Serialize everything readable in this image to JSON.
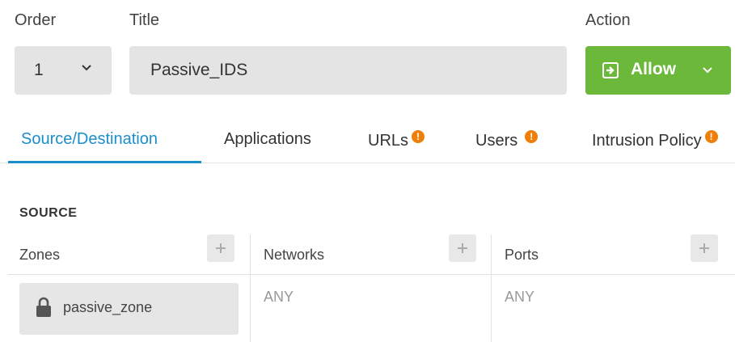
{
  "header": {
    "order_label": "Order",
    "title_label": "Title",
    "action_label": "Action"
  },
  "order": {
    "value": "1"
  },
  "title": {
    "value": "Passive_IDS"
  },
  "action": {
    "value": "Allow",
    "color": "#6cb83a"
  },
  "tabs": [
    {
      "label": "Source/Destination",
      "active": true,
      "warning": false
    },
    {
      "label": "Applications",
      "active": false,
      "warning": false
    },
    {
      "label": "URLs",
      "active": false,
      "warning": true
    },
    {
      "label": "Users",
      "active": false,
      "warning": true
    },
    {
      "label": "Intrusion Policy",
      "active": false,
      "warning": true
    }
  ],
  "warning_glyph": "!",
  "source": {
    "title": "SOURCE",
    "columns": [
      {
        "label": "Zones"
      },
      {
        "label": "Networks"
      },
      {
        "label": "Ports"
      }
    ],
    "zones": [
      {
        "name": "passive_zone",
        "icon": "lock-icon"
      }
    ],
    "networks_value": "ANY",
    "ports_value": "ANY"
  },
  "colors": {
    "accent": "#1b8ec9",
    "warning": "#f07f09",
    "allow": "#6cb83a"
  }
}
